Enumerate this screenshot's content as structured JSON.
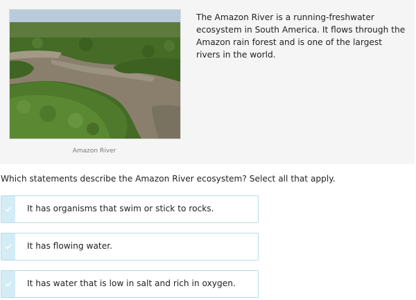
{
  "passage": {
    "text": "The Amazon River is a running-freshwater ecosystem in South America. It flows through the Amazon rain forest and is one of the largest rivers in the world.",
    "image_caption": "Amazon River"
  },
  "question": {
    "prompt": "Which statements describe the Amazon River ecosystem? Select all that apply."
  },
  "options": [
    {
      "label": "It has organisms that swim or stick to rocks."
    },
    {
      "label": "It has flowing water."
    },
    {
      "label": "It has water that is low in salt and rich in oxygen."
    }
  ],
  "colors": {
    "option_border": "#b5dbe8",
    "check_tab": "#d3ecf6",
    "panel_background": "#f5f5f5"
  }
}
